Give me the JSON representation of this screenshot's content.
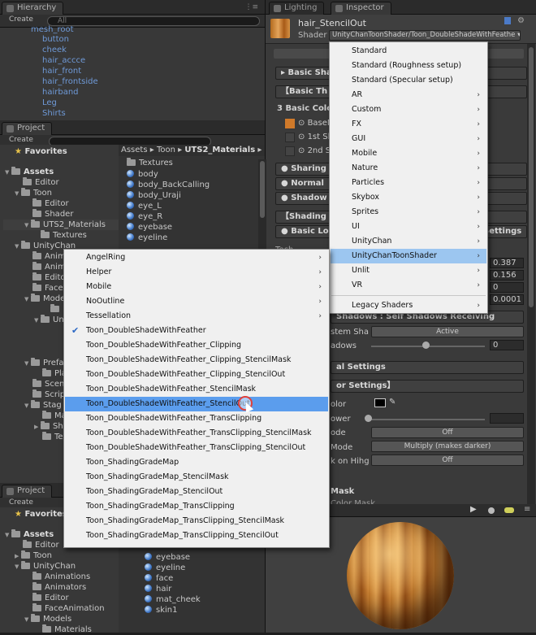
{
  "hierarchy": {
    "tab": "Hierarchy",
    "create": "Create",
    "search": "All",
    "items": [
      "mesh_root",
      "button",
      "cheek",
      "hair_accce",
      "hair_front",
      "hair_frontside",
      "hairband",
      "Leg",
      "Shirts"
    ]
  },
  "project1": {
    "tab": "Project",
    "create": "Create",
    "favorites": "Favorites",
    "tree": [
      "Assets",
      "Editor",
      "Toon",
      "Editor",
      "Shader",
      "UTS2_Materials",
      "Textures",
      "UnityChan",
      "Anim",
      "Anim",
      "Edito",
      "Face",
      "Mode",
      "Ma",
      "Uni",
      "Prefa",
      "Pla",
      "Scen",
      "Scrip",
      "Stag",
      "Ma",
      "Sh",
      "Tex"
    ],
    "breadcrumb": [
      "Assets",
      "Toon",
      "UTS2_Materials"
    ],
    "files": [
      "Textures",
      "body",
      "body_BackCalling",
      "body_Uraji",
      "eye_L",
      "eye_R",
      "eyebase",
      "eyeline"
    ]
  },
  "project2": {
    "tab": "Project",
    "create": "Create",
    "favorites": "Favorites",
    "tree": [
      "Assets",
      "Editor",
      "Toon",
      "UnityChan",
      "Animations",
      "Animators",
      "Editor",
      "FaceAnimation",
      "Models",
      "Materials"
    ],
    "files": [
      "eyebase",
      "eyeline",
      "face",
      "hair",
      "mat_cheek",
      "skin1"
    ]
  },
  "inspector": {
    "tab_lighting": "Lighting",
    "tab_inspector": "Inspector",
    "material_name": "hair_StencilOut",
    "shader_label": "Shader",
    "shader_value": "UnityChanToonShader/Toon_DoubleShadeWithFeathe",
    "sections": [
      "Basic Sha",
      "【Basic Th",
      "3 Basic Colo",
      "BaseM",
      "1st Sh",
      "2nd S",
      "Sharing",
      "Normal",
      "Shadow",
      "【Shading",
      "Basic Lo",
      "Settings"
    ],
    "values": [
      "0.387",
      "0.156",
      "0",
      "0.0001",
      "Active",
      "0",
      "Off",
      "Multiply (makes darker)",
      "Off"
    ],
    "labels": [
      "Shadows : Self Shadows Receiving",
      "stem Sha",
      "adows",
      "al Settings",
      "or Settings】",
      "olor",
      "ower",
      "ode",
      "Mode",
      "k on Hihg",
      "Mask",
      "Color Mask"
    ]
  },
  "shader_menu": {
    "items": [
      {
        "label": "Standard",
        "sub": false
      },
      {
        "label": "Standard (Roughness setup)",
        "sub": false
      },
      {
        "label": "Standard (Specular setup)",
        "sub": false
      },
      {
        "label": "AR",
        "sub": true
      },
      {
        "label": "Custom",
        "sub": true
      },
      {
        "label": "FX",
        "sub": true
      },
      {
        "label": "GUI",
        "sub": true
      },
      {
        "label": "Mobile",
        "sub": true
      },
      {
        "label": "Nature",
        "sub": true
      },
      {
        "label": "Particles",
        "sub": true
      },
      {
        "label": "Skybox",
        "sub": true
      },
      {
        "label": "Sprites",
        "sub": true
      },
      {
        "label": "UI",
        "sub": true
      },
      {
        "label": "UnityChan",
        "sub": true
      },
      {
        "label": "UnityChanToonShader",
        "sub": true
      },
      {
        "label": "Unlit",
        "sub": true
      },
      {
        "label": "VR",
        "sub": true
      },
      {
        "label": "Legacy Shaders",
        "sub": true
      }
    ]
  },
  "toon_menu": {
    "items": [
      {
        "label": "AngelRing",
        "sub": true
      },
      {
        "label": "Helper",
        "sub": true
      },
      {
        "label": "Mobile",
        "sub": true
      },
      {
        "label": "NoOutline",
        "sub": true
      },
      {
        "label": "Tessellation",
        "sub": true
      },
      {
        "label": "Toon_DoubleShadeWithFeather",
        "sub": false
      },
      {
        "label": "Toon_DoubleShadeWithFeather_Clipping",
        "sub": false
      },
      {
        "label": "Toon_DoubleShadeWithFeather_Clipping_StencilMask",
        "sub": false
      },
      {
        "label": "Toon_DoubleShadeWithFeather_Clipping_StencilOut",
        "sub": false
      },
      {
        "label": "Toon_DoubleShadeWithFeather_StencilMask",
        "sub": false
      },
      {
        "label": "Toon_DoubleShadeWithFeather_StencilOut",
        "sub": false
      },
      {
        "label": "Toon_DoubleShadeWithFeather_TransClipping",
        "sub": false
      },
      {
        "label": "Toon_DoubleShadeWithFeather_TransClipping_StencilMask",
        "sub": false
      },
      {
        "label": "Toon_DoubleShadeWithFeather_TransClipping_StencilOut",
        "sub": false
      },
      {
        "label": "Toon_ShadingGradeMap",
        "sub": false
      },
      {
        "label": "Toon_ShadingGradeMap_StencilMask",
        "sub": false
      },
      {
        "label": "Toon_ShadingGradeMap_StencilOut",
        "sub": false
      },
      {
        "label": "Toon_ShadingGradeMap_TransClipping",
        "sub": false
      },
      {
        "label": "Toon_ShadingGradeMap_TransClipping_StencilMask",
        "sub": false
      },
      {
        "label": "Toon_ShadingGradeMap_TransClipping_StencilOut",
        "sub": false
      }
    ],
    "checked": "Toon_DoubleShadeWithFeather",
    "selected": "Toon_DoubleShadeWithFeather_StencilOut"
  },
  "colors": {
    "accent": "#5b9ded",
    "hover": "#9cc6f0",
    "blue_text": "#6f9ad8"
  }
}
